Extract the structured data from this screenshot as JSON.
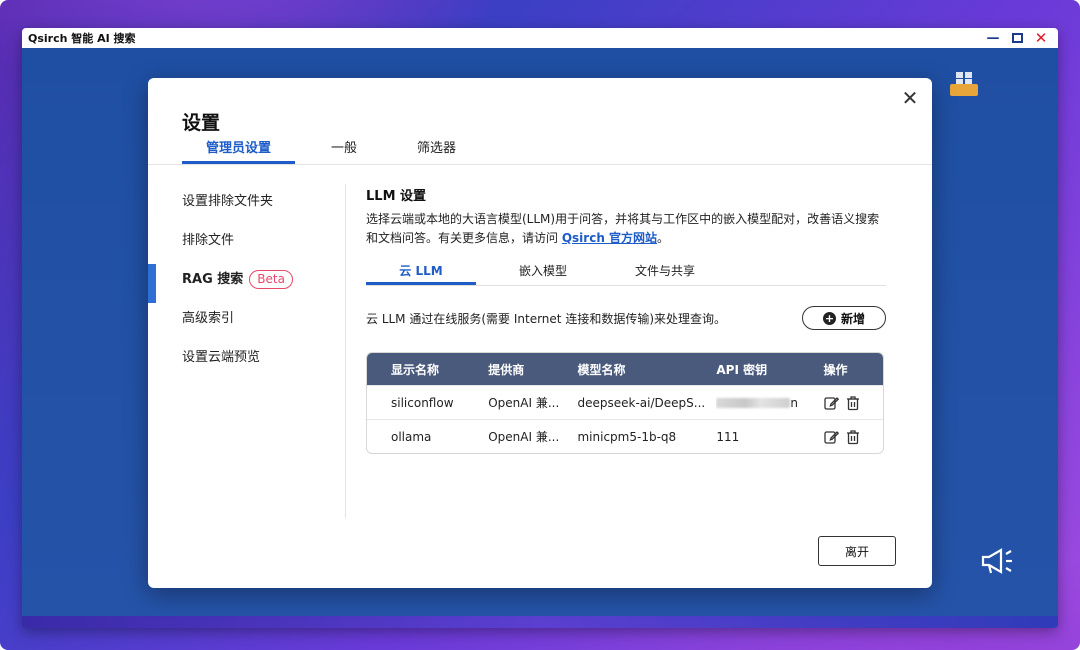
{
  "window": {
    "title": "Qsirch 智能 AI 搜索",
    "minimize": "—",
    "close": "✕"
  },
  "dialog": {
    "title": "设置",
    "close": "✕",
    "top_tabs": [
      {
        "label": "管理员设置",
        "active": true
      },
      {
        "label": "一般",
        "active": false
      },
      {
        "label": "筛选器",
        "active": false
      }
    ],
    "sidebar": [
      {
        "label": "设置排除文件夹",
        "active": false
      },
      {
        "label": "排除文件",
        "active": false
      },
      {
        "label": "RAG 搜索",
        "active": true,
        "badge": "Beta"
      },
      {
        "label": "高级索引",
        "active": false
      },
      {
        "label": "设置云端预览",
        "active": false
      }
    ],
    "section": {
      "title": "LLM 设置",
      "desc_prefix": "选择云端或本地的大语言模型(LLM)用于问答，并将其与工作区中的嵌入模型配对，改善语义搜索和文档问答。有关更多信息，请访问 ",
      "link": "Qsirch 官方网站",
      "desc_suffix": "。"
    },
    "sub_tabs": [
      {
        "label": "云 LLM",
        "active": true
      },
      {
        "label": "嵌入模型",
        "active": false
      },
      {
        "label": "文件与共享",
        "active": false
      }
    ],
    "cloud_desc": "云 LLM 通过在线服务(需要 Internet 连接和数据传输)来处理查询。",
    "add_button": "新增",
    "table": {
      "headers": [
        "显示名称",
        "提供商",
        "模型名称",
        "API 密钥",
        "操作"
      ],
      "rows": [
        {
          "name": "siliconflow",
          "provider": "OpenAI 兼...",
          "model": "deepseek-ai/DeepS...",
          "api_key": "",
          "api_key_tail": "n",
          "api_key_blurred": true
        },
        {
          "name": "ollama",
          "provider": "OpenAI 兼...",
          "model": "minicpm5-1b-q8",
          "api_key": "111",
          "api_key_tail": "",
          "api_key_blurred": false
        }
      ]
    },
    "leave_button": "离开"
  },
  "colors": {
    "accent": "#1e5cc8",
    "badge": "#e8486a",
    "table_header": "#4a5a7c",
    "app_background": "#2553a8",
    "close_red": "#e0192b"
  },
  "icons": [
    "close-icon",
    "minimize-icon",
    "maximize-icon",
    "plus-circle-icon",
    "edit-icon",
    "trash-icon",
    "megaphone-icon",
    "app-icon"
  ]
}
